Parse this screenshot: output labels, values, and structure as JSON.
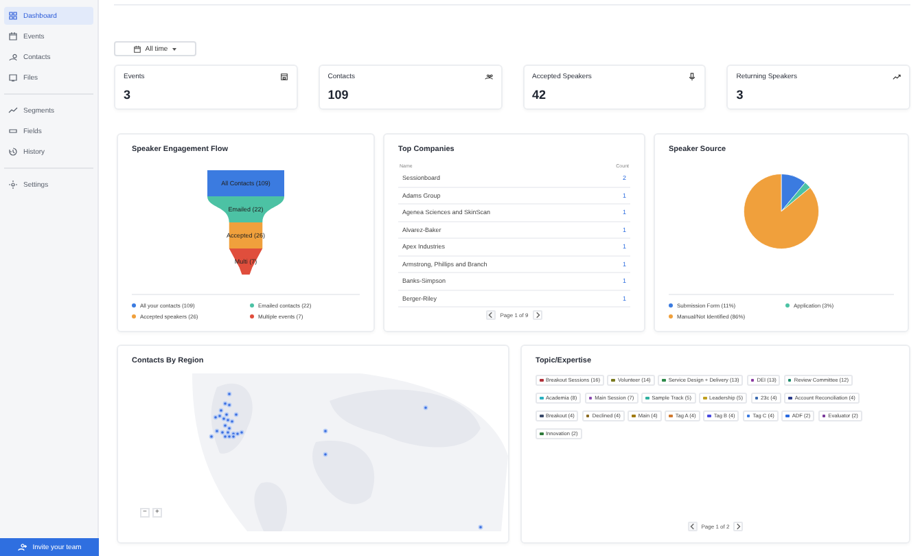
{
  "sidebar": {
    "groups": [
      [
        {
          "label": "Dashboard",
          "selected": true
        },
        {
          "label": "Events",
          "selected": false
        },
        {
          "label": "Contacts",
          "selected": false
        },
        {
          "label": "Files",
          "selected": false
        }
      ],
      [
        {
          "label": "Segments",
          "selected": false
        },
        {
          "label": "Fields",
          "selected": false
        },
        {
          "label": "History",
          "selected": false
        }
      ],
      [
        {
          "label": "Settings",
          "selected": false
        }
      ]
    ],
    "invite_button": "Invite your team"
  },
  "date_filter": "All time",
  "stats": [
    {
      "label": "Events",
      "value": "3"
    },
    {
      "label": "Contacts",
      "value": "109"
    },
    {
      "label": "Accepted Speakers",
      "value": "42"
    },
    {
      "label": "Returning Speakers",
      "value": "3"
    }
  ],
  "engagement_flow": {
    "title": "Speaker Engagement Flow",
    "stages": [
      {
        "label": "All Contacts (109)",
        "color": "#3b7be0"
      },
      {
        "label": "Emailed (22)",
        "color": "#4cc2a4"
      },
      {
        "label": "Accepted (26)",
        "color": "#f0a03c"
      },
      {
        "label": "Multi (7)",
        "color": "#e04e3c"
      }
    ],
    "legend": [
      {
        "label": "All your contacts (109)",
        "color": "#3b7be0"
      },
      {
        "label": "Emailed contacts (22)",
        "color": "#4cc2a4"
      },
      {
        "label": "Accepted speakers (26)",
        "color": "#f0a03c"
      },
      {
        "label": "Multiple events (7)",
        "color": "#e04e3c"
      }
    ]
  },
  "top_companies": {
    "title": "Top Companies",
    "columns": [
      "Name",
      "Count"
    ],
    "rows": [
      [
        "Sessionboard",
        "2"
      ],
      [
        "Adams Group",
        "1"
      ],
      [
        "Agenea Sciences and SkinScan",
        "1"
      ],
      [
        "Alvarez-Baker",
        "1"
      ],
      [
        "Apex Industries",
        "1"
      ],
      [
        "Armstrong, Phillips and Branch",
        "1"
      ],
      [
        "Banks-Simpson",
        "1"
      ],
      [
        "Berger-Riley",
        "1"
      ]
    ],
    "pager": "Page 1 of 9"
  },
  "speaker_source": {
    "title": "Speaker Source",
    "chart_data": {
      "type": "pie",
      "values": [
        11,
        3,
        86
      ]
    },
    "legend": [
      {
        "label": "Submission Form (11%)",
        "color": "#3b7be0"
      },
      {
        "label": "Application (3%)",
        "color": "#4cc2a4"
      },
      {
        "label": "Manual/Not Identified (86%)",
        "color": "#f0a03c"
      }
    ]
  },
  "contacts_by_region": {
    "title": "Contacts By Region",
    "zoom_out": "−",
    "zoom_in": "+"
  },
  "topics": {
    "title": "Topic/Expertise",
    "tags": [
      {
        "label": "Breakout Sessions (16)",
        "color": "#b0303a"
      },
      {
        "label": "Volunteer (14)",
        "color": "#7a7a20"
      },
      {
        "label": "Service Design + Delivery (13)",
        "color": "#2e8a4a"
      },
      {
        "label": "DEI (13)",
        "color": "#8a3aa0"
      },
      {
        "label": "Review Committee (12)",
        "color": "#1e8a6a"
      },
      {
        "label": "Academia (8)",
        "color": "#2ab0c0"
      },
      {
        "label": "Main Session (7)",
        "color": "#8a4ab0"
      },
      {
        "label": "Sample Track (5)",
        "color": "#30b0a0"
      },
      {
        "label": "Leadership (5)",
        "color": "#c0a020"
      },
      {
        "label": "23c (4)",
        "color": "#3a6ab0"
      },
      {
        "label": "Account Reconciliation (4)",
        "color": "#2a3a8a"
      },
      {
        "label": "Breakout (4)",
        "color": "#3a4a6a"
      },
      {
        "label": "Declined (4)",
        "color": "#8a6a20"
      },
      {
        "label": "Main (4)",
        "color": "#a07a10"
      },
      {
        "label": "Tag A (4)",
        "color": "#d07a30"
      },
      {
        "label": "Tag B (4)",
        "color": "#4a4ae0"
      },
      {
        "label": "Tag C (4)",
        "color": "#3a7ae0"
      },
      {
        "label": "ADF (2)",
        "color": "#2a6ae0"
      },
      {
        "label": "Evaluator (2)",
        "color": "#7a3a9a"
      },
      {
        "label": "Innovation (2)",
        "color": "#2e7a3a"
      }
    ],
    "pager": "Page 1 of 2"
  }
}
